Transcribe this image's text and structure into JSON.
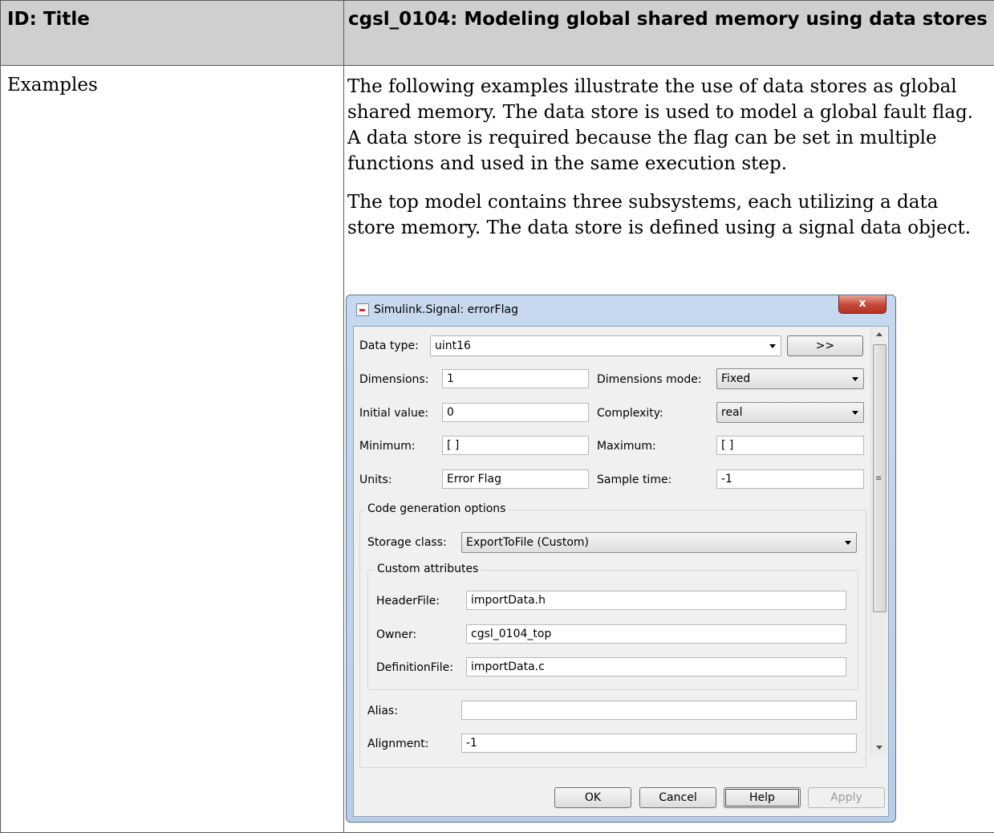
{
  "table": {
    "header_col1": "ID: Title",
    "header_col2": "cgsl_0104: Modeling global shared memory using data stores",
    "row_label": "Examples",
    "paragraph1": "The following examples illustrate the use of data stores as global shared memory. The data store is used to model a global fault flag. A data store is required because the flag can be set in multiple functions and used in the same execution step.",
    "paragraph2": "The top model contains three subsystems, each utilizing a data store memory. The data store is defined using a signal data object."
  },
  "dialog": {
    "title": "Simulink.Signal: errorFlag",
    "close_icon": "x-icon",
    "close_label": "x",
    "data_type_label": "Data type:",
    "data_type_value": "uint16",
    "expand_button": ">>",
    "dimensions_label": "Dimensions:",
    "dimensions_value": "1",
    "dimensions_mode_label": "Dimensions mode:",
    "dimensions_mode_value": "Fixed",
    "initial_value_label": "Initial value:",
    "initial_value_value": "0",
    "complexity_label": "Complexity:",
    "complexity_value": "real",
    "minimum_label": "Minimum:",
    "minimum_value": "[ ]",
    "maximum_label": "Maximum:",
    "maximum_value": "[ ]",
    "units_label": "Units:",
    "units_value": "Error Flag",
    "sample_time_label": "Sample time:",
    "sample_time_value": "-1",
    "code_gen_group": "Code generation options",
    "storage_class_label": "Storage class:",
    "storage_class_value": "ExportToFile (Custom)",
    "custom_attributes_group": "Custom attributes",
    "header_file_label": "HeaderFile:",
    "header_file_value": "importData.h",
    "owner_label": "Owner:",
    "owner_value": "cgsl_0104_top",
    "definition_file_label": "DefinitionFile:",
    "definition_file_value": "importData.c",
    "alias_label": "Alias:",
    "alias_value": "",
    "alignment_label": "Alignment:",
    "alignment_value": "-1",
    "ok_button": "OK",
    "cancel_button": "Cancel",
    "help_button": "Help",
    "apply_button": "Apply",
    "scrollbar_grip": "≡"
  },
  "colors": {
    "header_bg": "#cfcfcf",
    "dialog_frame": "#b9cde6",
    "close_button": "#c44636"
  }
}
